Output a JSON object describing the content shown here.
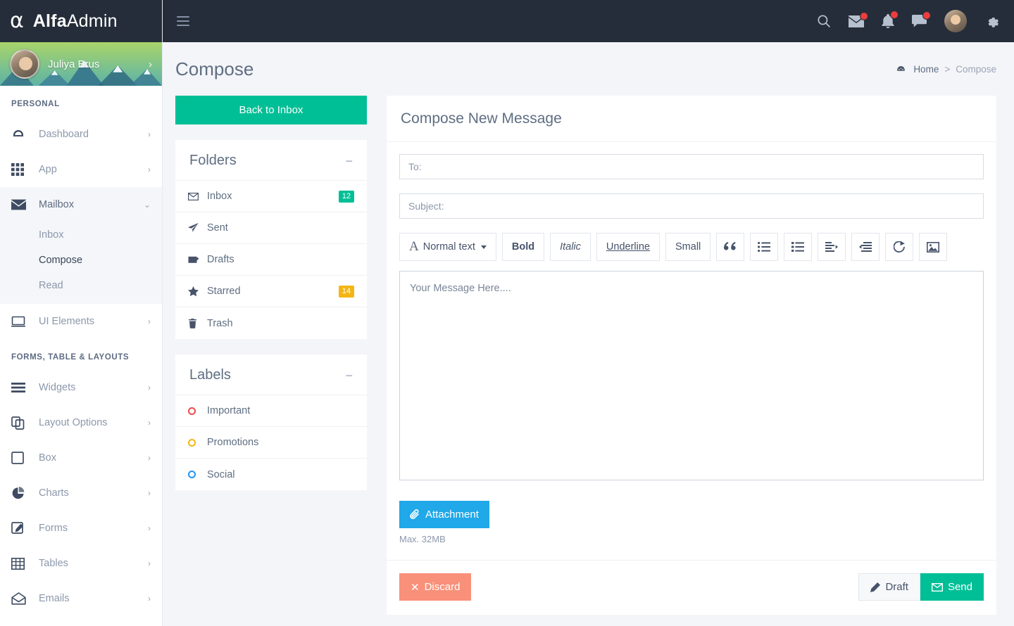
{
  "brand": {
    "bold": "Alfa",
    "light": "Admin",
    "logo_icon": "alpha-logo-icon"
  },
  "profile": {
    "name": "Juliya Brus",
    "chevron": "›"
  },
  "topbar": {
    "icons": [
      "search-icon",
      "envelope-icon",
      "bell-icon",
      "chat-icon",
      "gear-icon"
    ],
    "badge_color": "#ec3d3d"
  },
  "sidebar": {
    "sections": [
      {
        "title": "PERSONAL",
        "items": [
          {
            "label": "Dashboard",
            "icon": "speedometer-icon",
            "arrow": "›"
          },
          {
            "label": "App",
            "icon": "grid-icon",
            "arrow": "›"
          },
          {
            "label": "Mailbox",
            "icon": "envelope-icon",
            "arrow": "⌄",
            "open": true,
            "children": [
              {
                "label": "Inbox",
                "active": false
              },
              {
                "label": "Compose",
                "active": true
              },
              {
                "label": "Read",
                "active": false
              }
            ]
          },
          {
            "label": "UI Elements",
            "icon": "monitor-icon",
            "arrow": "›"
          }
        ]
      },
      {
        "title": "FORMS, TABLE & LAYOUTS",
        "items": [
          {
            "label": "Widgets",
            "icon": "bars-icon",
            "arrow": "›"
          },
          {
            "label": "Layout Options",
            "icon": "copy-icon",
            "arrow": "›"
          },
          {
            "label": "Box",
            "icon": "square-icon",
            "arrow": "›"
          },
          {
            "label": "Charts",
            "icon": "pie-chart-icon",
            "arrow": "›"
          },
          {
            "label": "Forms",
            "icon": "edit-icon",
            "arrow": "›"
          },
          {
            "label": "Tables",
            "icon": "table-icon",
            "arrow": "›"
          },
          {
            "label": "Emails",
            "icon": "open-envelope-icon",
            "arrow": "›"
          }
        ]
      }
    ]
  },
  "page": {
    "title": "Compose",
    "breadcrumb": {
      "home": "Home",
      "separator": ">",
      "current": "Compose",
      "icon": "speedometer-icon"
    }
  },
  "mail": {
    "back_to_inbox": "Back to Inbox",
    "folders_card": {
      "title": "Folders",
      "collapse": "−",
      "rows": [
        {
          "label": "Inbox",
          "icon": "envelope-icon",
          "badge": "12",
          "badge_color": "#00bf96"
        },
        {
          "label": "Sent",
          "icon": "paper-plane-icon",
          "badge": "",
          "badge_color": ""
        },
        {
          "label": "Drafts",
          "icon": "envelope-edit-icon",
          "badge": "",
          "badge_color": ""
        },
        {
          "label": "Starred",
          "icon": "star-icon",
          "badge": "14",
          "badge_color": "#f5b513"
        },
        {
          "label": "Trash",
          "icon": "trash-icon",
          "badge": "",
          "badge_color": ""
        }
      ]
    },
    "labels_card": {
      "title": "Labels",
      "collapse": "−",
      "rows": [
        {
          "label": "Important",
          "dot_color": "#ef4b4b"
        },
        {
          "label": "Promotions",
          "dot_color": "#f5b513"
        },
        {
          "label": "Social",
          "dot_color": "#2196f3"
        }
      ]
    }
  },
  "compose": {
    "card_title": "Compose New Message",
    "to": {
      "value": "",
      "placeholder": "To:"
    },
    "subject": {
      "value": "",
      "placeholder": "Subject:"
    },
    "toolbar": {
      "style_label": "Normal text",
      "style_glyph": "A",
      "bold": "Bold",
      "italic": "Italic",
      "underline": "Underline",
      "small": "Small",
      "icon_buttons": [
        "quote-icon",
        "unordered-list-icon",
        "ordered-list-icon",
        "indent-icon",
        "outdent-icon",
        "link-share-icon",
        "image-icon"
      ]
    },
    "message": {
      "value": "",
      "placeholder": "Your Message Here...."
    },
    "attachment": {
      "label": "Attachment",
      "icon": "paperclip-icon",
      "note": "Max. 32MB",
      "color": "#20a8e8"
    },
    "discard": {
      "label": "Discard",
      "icon": "close-icon",
      "color": "#f9907a"
    },
    "draft": {
      "label": "Draft",
      "icon": "pencil-icon"
    },
    "send": {
      "label": "Send",
      "icon": "envelope-icon",
      "color": "#00bf96"
    }
  }
}
